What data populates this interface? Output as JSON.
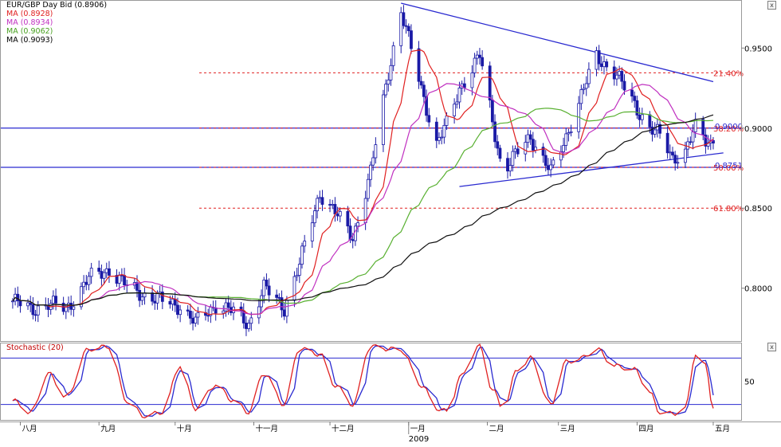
{
  "legend": {
    "title": "EUR/GBP Day Bid (0.8906)",
    "ma1": "MA (0.8928)",
    "ma2": "MA (0.8934)",
    "ma3": "MA (0.9062)",
    "ma4": "MA (0.9093)"
  },
  "stochastic_title": "Stochastic (20)",
  "close_glyph": "x",
  "colors": {
    "candle": "#1a1aa6",
    "ma1": "#e02020",
    "ma2": "#c030c0",
    "ma3": "#58b030",
    "ma4": "#101010",
    "trendline": "#2a2ad0",
    "fib": "#e02020",
    "stoch_k": "#e02020",
    "stoch_d": "#2a2ad0"
  },
  "chart_data": {
    "type": "candlestick",
    "instrument": "EUR/GBP Day Bid",
    "last": 0.8906,
    "y_ticks": [
      "0.9500",
      "0.9000",
      "0.8500",
      "0.8000"
    ],
    "y_range": [
      0.767,
      0.98
    ],
    "x_months": [
      "八月",
      "九月",
      "十月",
      "十一月",
      "十二月",
      "一月",
      "二月",
      "三月",
      "四月",
      "五月"
    ],
    "x_year": "2009",
    "horizontal_levels": [
      {
        "value": 0.9,
        "style": "solid",
        "label": "0.9000"
      },
      {
        "value": 0.8755,
        "style": "solid",
        "label": "0.8751"
      }
    ],
    "fib_levels": [
      {
        "value": 0.9345,
        "label": "21.40%"
      },
      {
        "value": 0.9,
        "label": "38.20%"
      },
      {
        "value": 0.8755,
        "label": "50.00%"
      },
      {
        "value": 0.85,
        "label": "61.80%"
      }
    ],
    "trendlines": [
      {
        "from": [
          "2008-12-29",
          0.978
        ],
        "to": [
          "2009-05-01",
          0.929
        ]
      },
      {
        "from": [
          "2009-01-21",
          0.8635
        ],
        "to": [
          "2009-05-05",
          0.8845
        ]
      }
    ],
    "anchors": [
      [
        "2008-07-29",
        0.792
      ],
      [
        "2008-08-05",
        0.787
      ],
      [
        "2008-08-12",
        0.79
      ],
      [
        "2008-08-19",
        0.787
      ],
      [
        "2008-08-28",
        0.806
      ],
      [
        "2008-09-05",
        0.812
      ],
      [
        "2008-09-12",
        0.801
      ],
      [
        "2008-09-19",
        0.796
      ],
      [
        "2008-09-26",
        0.792
      ],
      [
        "2008-10-03",
        0.789
      ],
      [
        "2008-10-09",
        0.778
      ],
      [
        "2008-10-17",
        0.79
      ],
      [
        "2008-10-24",
        0.785
      ],
      [
        "2008-10-30",
        0.778
      ],
      [
        "2008-11-05",
        0.8
      ],
      [
        "2008-11-13",
        0.788
      ],
      [
        "2008-11-19",
        0.815
      ],
      [
        "2008-11-27",
        0.86
      ],
      [
        "2008-12-03",
        0.847
      ],
      [
        "2008-12-10",
        0.832
      ],
      [
        "2008-12-17",
        0.872
      ],
      [
        "2008-12-24",
        0.935
      ],
      [
        "2008-12-29",
        0.973
      ],
      [
        "2009-01-06",
        0.925
      ],
      [
        "2009-01-12",
        0.89
      ],
      [
        "2009-01-17",
        0.905
      ],
      [
        "2009-01-21",
        0.925
      ],
      [
        "2009-01-29",
        0.945
      ],
      [
        "2009-02-03",
        0.905
      ],
      [
        "2009-02-07",
        0.872
      ],
      [
        "2009-02-13",
        0.885
      ],
      [
        "2009-02-18",
        0.895
      ],
      [
        "2009-02-26",
        0.872
      ],
      [
        "2009-03-04",
        0.895
      ],
      [
        "2009-03-10",
        0.92
      ],
      [
        "2009-03-16",
        0.945
      ],
      [
        "2009-03-23",
        0.935
      ],
      [
        "2009-03-31",
        0.915
      ],
      [
        "2009-04-06",
        0.9
      ],
      [
        "2009-04-10",
        0.895
      ],
      [
        "2009-04-15",
        0.882
      ],
      [
        "2009-04-20",
        0.885
      ],
      [
        "2009-04-24",
        0.9
      ],
      [
        "2009-04-28",
        0.893
      ],
      [
        "2009-05-01",
        0.8906
      ]
    ],
    "moving_averages": [
      {
        "name": "MA (0.8928)",
        "value": 0.8928,
        "color_key": "ma1"
      },
      {
        "name": "MA (0.8934)",
        "value": 0.8934,
        "color_key": "ma2"
      },
      {
        "name": "MA (0.9062)",
        "value": 0.9062,
        "color_key": "ma3"
      },
      {
        "name": "MA (0.9093)",
        "value": 0.9093,
        "color_key": "ma4"
      }
    ],
    "stochastic": {
      "name": "Stochastic (20)",
      "y_tick": "50",
      "levels": [
        80,
        20
      ],
      "y_range": [
        0,
        100
      ],
      "anchors": [
        [
          "2008-07-29",
          25
        ],
        [
          "2008-08-05",
          10
        ],
        [
          "2008-08-12",
          60
        ],
        [
          "2008-08-19",
          30
        ],
        [
          "2008-08-28",
          92
        ],
        [
          "2008-09-05",
          95
        ],
        [
          "2008-09-12",
          25
        ],
        [
          "2008-09-19",
          5
        ],
        [
          "2008-09-26",
          10
        ],
        [
          "2008-10-03",
          70
        ],
        [
          "2008-10-09",
          15
        ],
        [
          "2008-10-17",
          45
        ],
        [
          "2008-10-24",
          25
        ],
        [
          "2008-10-30",
          10
        ],
        [
          "2008-11-05",
          60
        ],
        [
          "2008-11-13",
          20
        ],
        [
          "2008-11-19",
          92
        ],
        [
          "2008-11-27",
          85
        ],
        [
          "2008-12-03",
          45
        ],
        [
          "2008-12-10",
          20
        ],
        [
          "2008-12-17",
          95
        ],
        [
          "2008-12-24",
          92
        ],
        [
          "2008-12-29",
          90
        ],
        [
          "2009-01-06",
          45
        ],
        [
          "2009-01-12",
          15
        ],
        [
          "2009-01-17",
          10
        ],
        [
          "2009-01-21",
          55
        ],
        [
          "2009-01-29",
          95
        ],
        [
          "2009-02-03",
          40
        ],
        [
          "2009-02-07",
          15
        ],
        [
          "2009-02-13",
          65
        ],
        [
          "2009-02-18",
          80
        ],
        [
          "2009-02-26",
          20
        ],
        [
          "2009-03-04",
          75
        ],
        [
          "2009-03-10",
          80
        ],
        [
          "2009-03-16",
          92
        ],
        [
          "2009-03-23",
          70
        ],
        [
          "2009-03-31",
          65
        ],
        [
          "2009-04-06",
          35
        ],
        [
          "2009-04-10",
          10
        ],
        [
          "2009-04-15",
          8
        ],
        [
          "2009-04-20",
          15
        ],
        [
          "2009-04-24",
          85
        ],
        [
          "2009-04-28",
          70
        ],
        [
          "2009-05-01",
          15
        ]
      ]
    }
  }
}
